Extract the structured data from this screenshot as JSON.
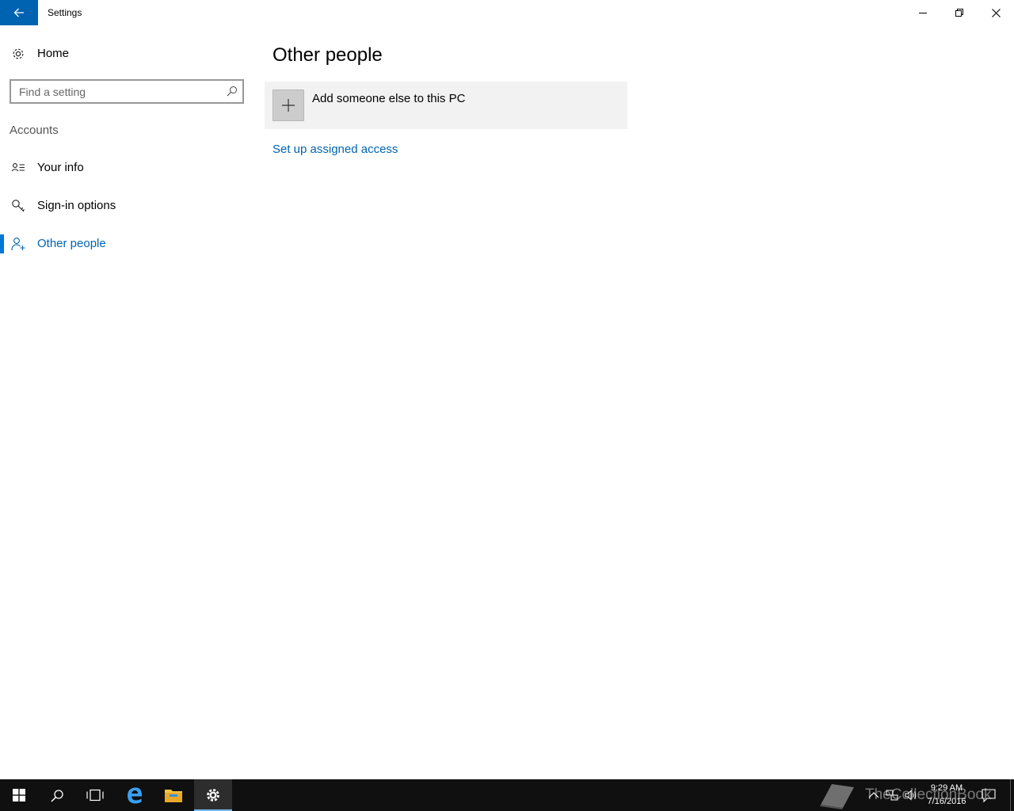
{
  "window": {
    "title": "Settings"
  },
  "sidebar": {
    "home_label": "Home",
    "search_placeholder": "Find a setting",
    "section_label": "Accounts",
    "items": [
      {
        "label": "Your info",
        "icon": "contact-card-icon"
      },
      {
        "label": "Sign-in options",
        "icon": "key-icon"
      },
      {
        "label": "Other people",
        "icon": "person-add-icon",
        "active": true
      }
    ]
  },
  "main": {
    "title": "Other people",
    "add_label": "Add someone else to this PC",
    "assigned_access_link": "Set up assigned access"
  },
  "taskbar": {
    "watermark": "TheCollectionBook",
    "time": "9:29 AM",
    "date": "7/16/2016"
  },
  "colors": {
    "accent": "#0063b1",
    "selection_indicator": "#0078d7",
    "tile_background": "#f2f2f2",
    "taskbar": "#101010"
  }
}
